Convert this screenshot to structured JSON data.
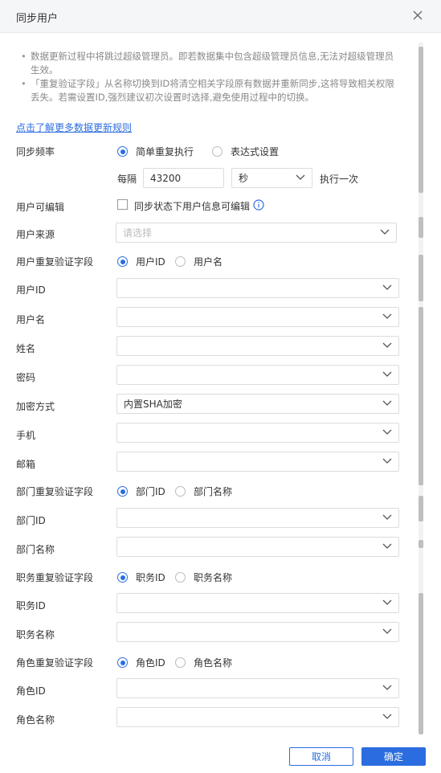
{
  "dialog": {
    "title": "同步用户"
  },
  "notice": [
    "数据更新过程中将跳过超级管理员。即若数据集中包含超级管理员信息,无法对超级管理员生效。",
    "「重复验证字段」从名称切换到ID将清空相关字段原有数据并重新同步,这将导致相关权限丢失。若需设置ID,强烈建议初次设置时选择,避免使用过程中的切换。"
  ],
  "notice_line1a": "数据更新过程中将跳过超级管理员。即若数据集中包含超级管理员信息,无法对超级管理员",
  "notice_line1b": "生效。",
  "notice_line2a": "「重复验证字段」从名称切换到ID将清空相关字段原有数据并重新同步,这将导致相关权限",
  "notice_line2b": "丢失。若需设置ID,强烈建议初次设置时选择,避免使用过程中的切换。",
  "link": "点击了解更多数据更新规则",
  "sync": {
    "label": "同步频率",
    "option_simple": "简单重复执行",
    "option_expr": "表达式设置",
    "every_label": "每隔",
    "interval_value": "43200",
    "unit_value": "秒",
    "run_once": "执行一次"
  },
  "editable": {
    "label": "用户可编辑",
    "checkbox_label": "同步状态下用户信息可编辑"
  },
  "source": {
    "label": "用户来源",
    "placeholder": "请选择"
  },
  "user_dup": {
    "label": "用户重复验证字段",
    "opt1": "用户ID",
    "opt2": "用户名"
  },
  "fields": {
    "user_id": {
      "label": "用户ID",
      "value": ""
    },
    "username": {
      "label": "用户名",
      "value": ""
    },
    "name": {
      "label": "姓名",
      "value": ""
    },
    "password": {
      "label": "密码",
      "value": ""
    },
    "encryption": {
      "label": "加密方式",
      "value": "内置SHA加密"
    },
    "phone": {
      "label": "手机",
      "value": ""
    },
    "email": {
      "label": "邮箱",
      "value": ""
    },
    "dept_id": {
      "label": "部门ID",
      "value": ""
    },
    "dept_name": {
      "label": "部门名称",
      "value": ""
    },
    "job_id": {
      "label": "职务ID",
      "value": ""
    },
    "job_name": {
      "label": "职务名称",
      "value": ""
    },
    "role_id": {
      "label": "角色ID",
      "value": ""
    },
    "role_name": {
      "label": "角色名称",
      "value": ""
    }
  },
  "dept_dup": {
    "label": "部门重复验证字段",
    "opt1": "部门ID",
    "opt2": "部门名称"
  },
  "job_dup": {
    "label": "职务重复验证字段",
    "opt1": "职务ID",
    "opt2": "职务名称"
  },
  "role_dup": {
    "label": "角色重复验证字段",
    "opt1": "角色ID",
    "opt2": "角色名称"
  },
  "buttons": {
    "cancel": "取消",
    "ok": "确定"
  },
  "colors": {
    "accent": "#2b6de0",
    "header_bg": "#f5f6f8"
  }
}
